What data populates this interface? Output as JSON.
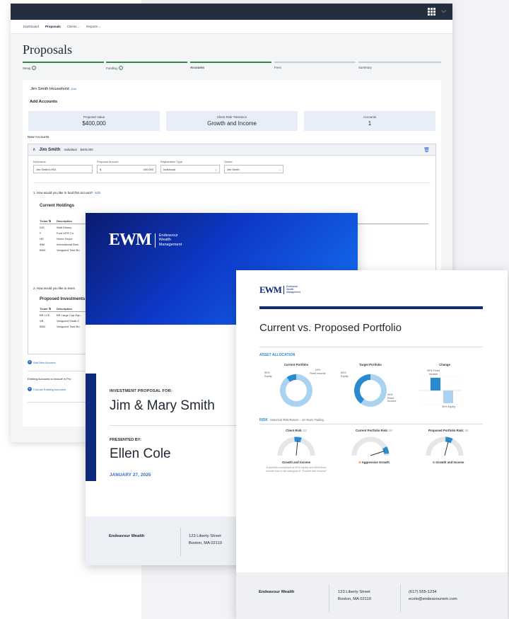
{
  "app": {
    "nav": [
      "Dashboard",
      "Proposals",
      "Clients ⌵",
      "Reports ⌵"
    ],
    "page_title": "Proposals",
    "steps": [
      "Setup",
      "Funding",
      "Accounts",
      "Fees",
      "Summary"
    ],
    "household": "Jim Smith Household",
    "edit_label": "Edit",
    "add_accounts": "Add Accounts",
    "cards": [
      {
        "label": "Proposal Value",
        "value": "$400,000"
      },
      {
        "label": "Client Risk Tolerance",
        "value": "Growth and Income"
      },
      {
        "label": "Accounts",
        "value": "1"
      }
    ],
    "new_accounts": "New Accounts",
    "account": {
      "name": "Jim Smith",
      "type": "Individual",
      "amount": "$400,000"
    },
    "fields": {
      "nickname_label": "Nickname",
      "nickname": "Jim Smith's IRA",
      "amount_label": "Proposal Amount",
      "currency": "$",
      "amount": "400,000",
      "reg_label": "Registration Type",
      "reg": "Individual",
      "owner_label": "Owner",
      "owner": "Jim Smith"
    },
    "q1": "1. How would you like to fund this account?",
    "current_holdings": "Current Holdings",
    "holdings_headers": [
      "Ticker ⇅",
      "Description"
    ],
    "holdings": [
      [
        "DIS",
        "Walt Disney"
      ],
      [
        "F",
        "Ford MTR Co"
      ],
      [
        "HD",
        "Home Depot"
      ],
      [
        "IBM",
        "International Busi"
      ],
      [
        "BND",
        "Vanguard Total Bo"
      ]
    ],
    "q2": "2. How would you like to inves",
    "proposed_investments": "Proposed Investments",
    "proposed": [
      [
        "BR LCE",
        "BR Large Cap Equ"
      ],
      [
        "VB",
        "Vanguard Small-C"
      ],
      [
        "BND",
        "Vanguard Total Bo"
      ]
    ],
    "add_new_account": "Add New Account",
    "existing_label": "Existing Accounts to Include in Pro",
    "choose_existing": "Choose Existing Accounts"
  },
  "cover": {
    "logo_mark": "EWM",
    "logo_text": [
      "Endeavour",
      "Wealth",
      "Management"
    ],
    "for_label": "INVESTMENT PROPOSAL FOR:",
    "client": "Jim & Mary Smith",
    "presented_label": "PRESENTED BY:",
    "presenter": "Ellen Cole",
    "date": "JANUARY 27, 2025",
    "firm": "Endeavour Wealth",
    "address": [
      "123 Liberty Street",
      "Boston, MA 02110"
    ]
  },
  "report": {
    "logo_mark": "EWM",
    "logo_text": [
      "Endeavour",
      "Wealth",
      "Management"
    ],
    "title": "Current vs. Proposed Portfolio",
    "asset_allocation": "ASSET ALLOCATION",
    "charts": {
      "current": {
        "title": "Current Portfolio",
        "labels": [
          "90%\nEquity",
          "10%\nFixed Income"
        ]
      },
      "target": {
        "title": "Target Portfolio",
        "labels": [
          "60%\nEquity",
          "40%\nFixed\nIncome"
        ]
      },
      "change": {
        "title": "Change",
        "labels": [
          "30% Fixed\nIncome",
          "30% Equity"
        ]
      }
    },
    "risk": "RISK",
    "risk_sub": "Historical Risk/Return – 10 Years Trailing",
    "gauges": [
      {
        "title": "Client Risk:",
        "score": "53",
        "label": "Growth and Income",
        "note": "A portfolio comprised of 50% equity and 50% fixed income has a risk category of \"Growth and Income\""
      },
      {
        "title": "Current Portfolio Risk:",
        "score": "90",
        "label": "Aggressive Growth"
      },
      {
        "title": "Proposed Portfolio Risk:",
        "score": "58",
        "label": "Growth and Income"
      }
    ],
    "firm": "Endeavour Wealth",
    "address": [
      "123 Liberty Street",
      "Boston, MA 02110"
    ],
    "contact": [
      "(617) 555-1234",
      "ecole@endeavourwm.com"
    ]
  },
  "chart_data": [
    {
      "type": "pie",
      "title": "Current Portfolio",
      "categories": [
        "Equity",
        "Fixed Income"
      ],
      "values": [
        90,
        10
      ]
    },
    {
      "type": "pie",
      "title": "Target Portfolio",
      "categories": [
        "Equity",
        "Fixed Income"
      ],
      "values": [
        60,
        40
      ]
    },
    {
      "type": "bar",
      "title": "Change",
      "categories": [
        "Fixed Income",
        "Equity"
      ],
      "values": [
        30,
        -30
      ]
    }
  ],
  "colors": {
    "navy": "#232f3e",
    "accent": "#2867c7",
    "green": "#2e8b45",
    "chart_dark": "#2a8ad0",
    "chart_light": "#a9d3f0"
  }
}
